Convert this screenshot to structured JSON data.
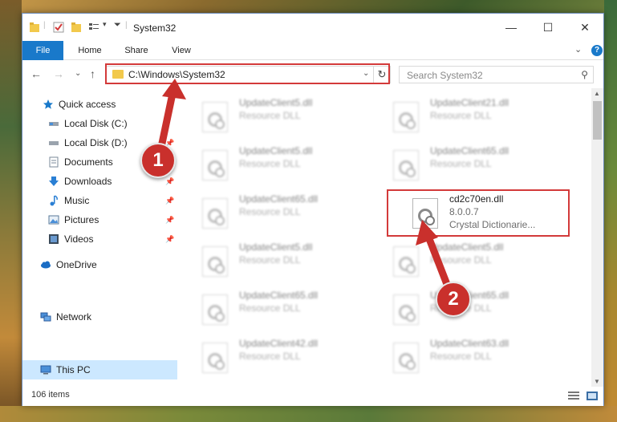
{
  "window": {
    "title": "System32",
    "controls": {
      "minimize": "—",
      "maximize": "☐",
      "close": "✕"
    }
  },
  "ribbon": {
    "tabs": [
      {
        "label": "File"
      },
      {
        "label": "Home"
      },
      {
        "label": "Share"
      },
      {
        "label": "View"
      }
    ],
    "expand_glyph": "⌄",
    "help_glyph": "?"
  },
  "navbar": {
    "back_glyph": "←",
    "forward_glyph": "→",
    "recent_glyph": "⌄",
    "up_glyph": "↑",
    "address": "C:\\Windows\\System32",
    "address_dropdown_glyph": "⌄",
    "refresh_glyph": "↻",
    "search_placeholder": "Search System32",
    "search_glyph": "⚲"
  },
  "sidebar": {
    "items": [
      {
        "label": "Quick access",
        "icon": "star-icon",
        "pinned": false
      },
      {
        "label": "Local Disk (C:)",
        "icon": "drive-icon",
        "pinned": false
      },
      {
        "label": "Local Disk (D:)",
        "icon": "drive-icon",
        "pinned": true
      },
      {
        "label": "Documents",
        "icon": "documents-icon",
        "pinned": true
      },
      {
        "label": "Downloads",
        "icon": "download-icon",
        "pinned": true
      },
      {
        "label": "Music",
        "icon": "music-icon",
        "pinned": true
      },
      {
        "label": "Pictures",
        "icon": "pictures-icon",
        "pinned": true
      },
      {
        "label": "Videos",
        "icon": "videos-icon",
        "pinned": true
      },
      {
        "label": "OneDrive",
        "icon": "cloud-icon",
        "pinned": false
      },
      {
        "label": "This PC",
        "icon": "computer-icon",
        "pinned": false,
        "selected": true
      },
      {
        "label": "Network",
        "icon": "network-icon",
        "pinned": false
      }
    ],
    "pin_glyph": "📌"
  },
  "files": {
    "left": [
      {
        "name": "UpdateClient5.dll",
        "type": "Resource DLL"
      },
      {
        "name": "UpdateClient5.dll",
        "type": "Resource DLL"
      },
      {
        "name": "UpdateClient65.dll",
        "type": "Resource DLL"
      },
      {
        "name": "UpdateClient5.dll",
        "type": "Resource DLL"
      },
      {
        "name": "UpdateClient65.dll",
        "type": "Resource DLL"
      },
      {
        "name": "UpdateClient42.dll",
        "type": "Resource DLL"
      }
    ],
    "right": [
      {
        "name": "UpdateClient21.dll",
        "type": "Resource DLL"
      },
      {
        "name": "UpdateClient65.dll",
        "type": "Resource DLL"
      },
      {
        "name": "cd2c70en.dll",
        "type": "8.0.0.7",
        "description": "Crystal Dictionarie..."
      },
      {
        "name": "UpdateClient5.dll",
        "type": "Resource DLL"
      },
      {
        "name": "UpdateClient65.dll",
        "type": "Resource DLL"
      },
      {
        "name": "UpdateClient63.dll",
        "type": "Resource DLL"
      }
    ]
  },
  "status": {
    "item_count": "106 items"
  },
  "callouts": {
    "one": "1",
    "two": "2"
  },
  "colors": {
    "accent": "#1979ca",
    "highlight_red": "#d33a3a",
    "callout_red": "#c9302c",
    "selected_bg": "#cce8ff"
  }
}
